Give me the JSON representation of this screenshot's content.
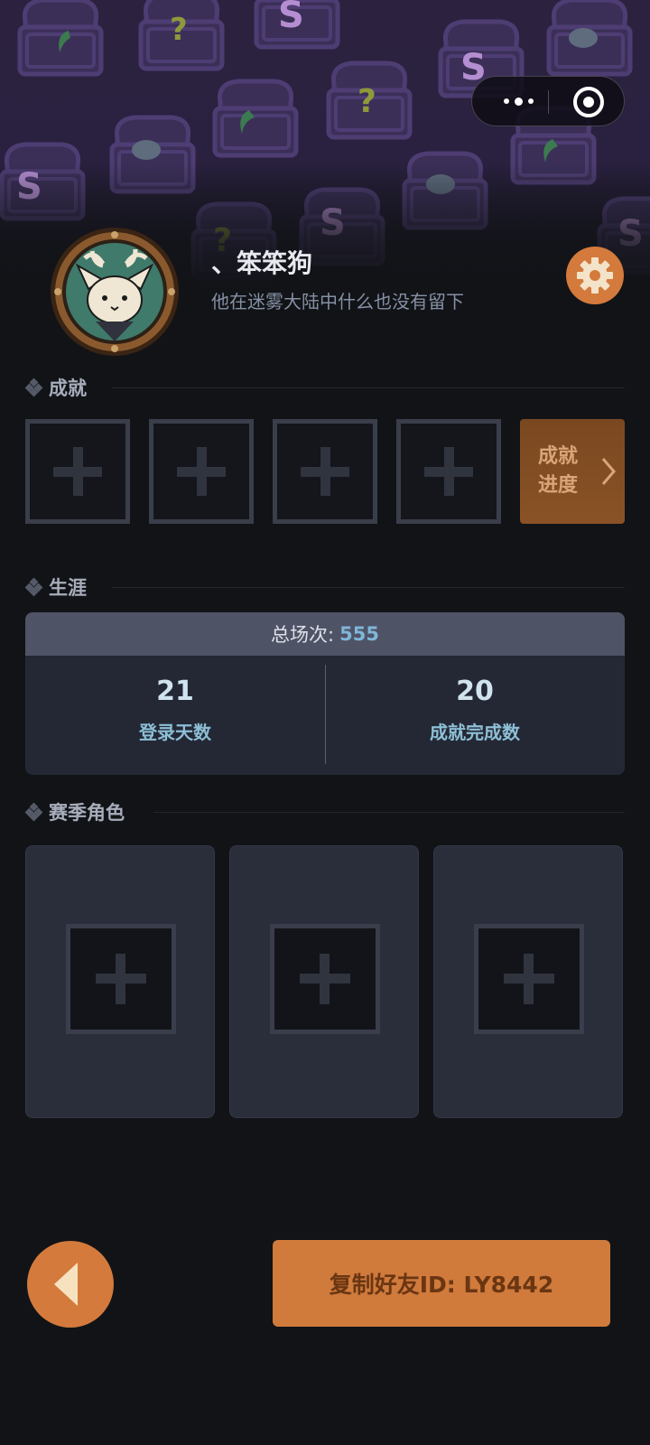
{
  "capsule": {
    "menu_icon": "more-dots-icon",
    "close_icon": "target-icon"
  },
  "profile": {
    "nickname": "、笨笨狗",
    "bio": "他在迷雾大陆中什么也没有留下",
    "settings_icon": "gear-icon"
  },
  "achievements": {
    "title": "成就",
    "slots": [
      "empty",
      "empty",
      "empty",
      "empty"
    ],
    "progress_label": "成就进度"
  },
  "career": {
    "title": "生涯",
    "total_label": "总场次:",
    "total_value": "555",
    "stats": [
      {
        "value": "21",
        "label": "登录天数"
      },
      {
        "value": "20",
        "label": "成就完成数"
      }
    ]
  },
  "season_roles": {
    "title": "赛季角色",
    "slots": [
      "empty",
      "empty",
      "empty"
    ]
  },
  "footer": {
    "back_icon": "back-arrow-icon",
    "copy_label": "复制好友ID: LY8442"
  },
  "colors": {
    "accent_orange": "#d07a3c",
    "background": "#111317",
    "highlight_blue": "#7fb6d8"
  }
}
